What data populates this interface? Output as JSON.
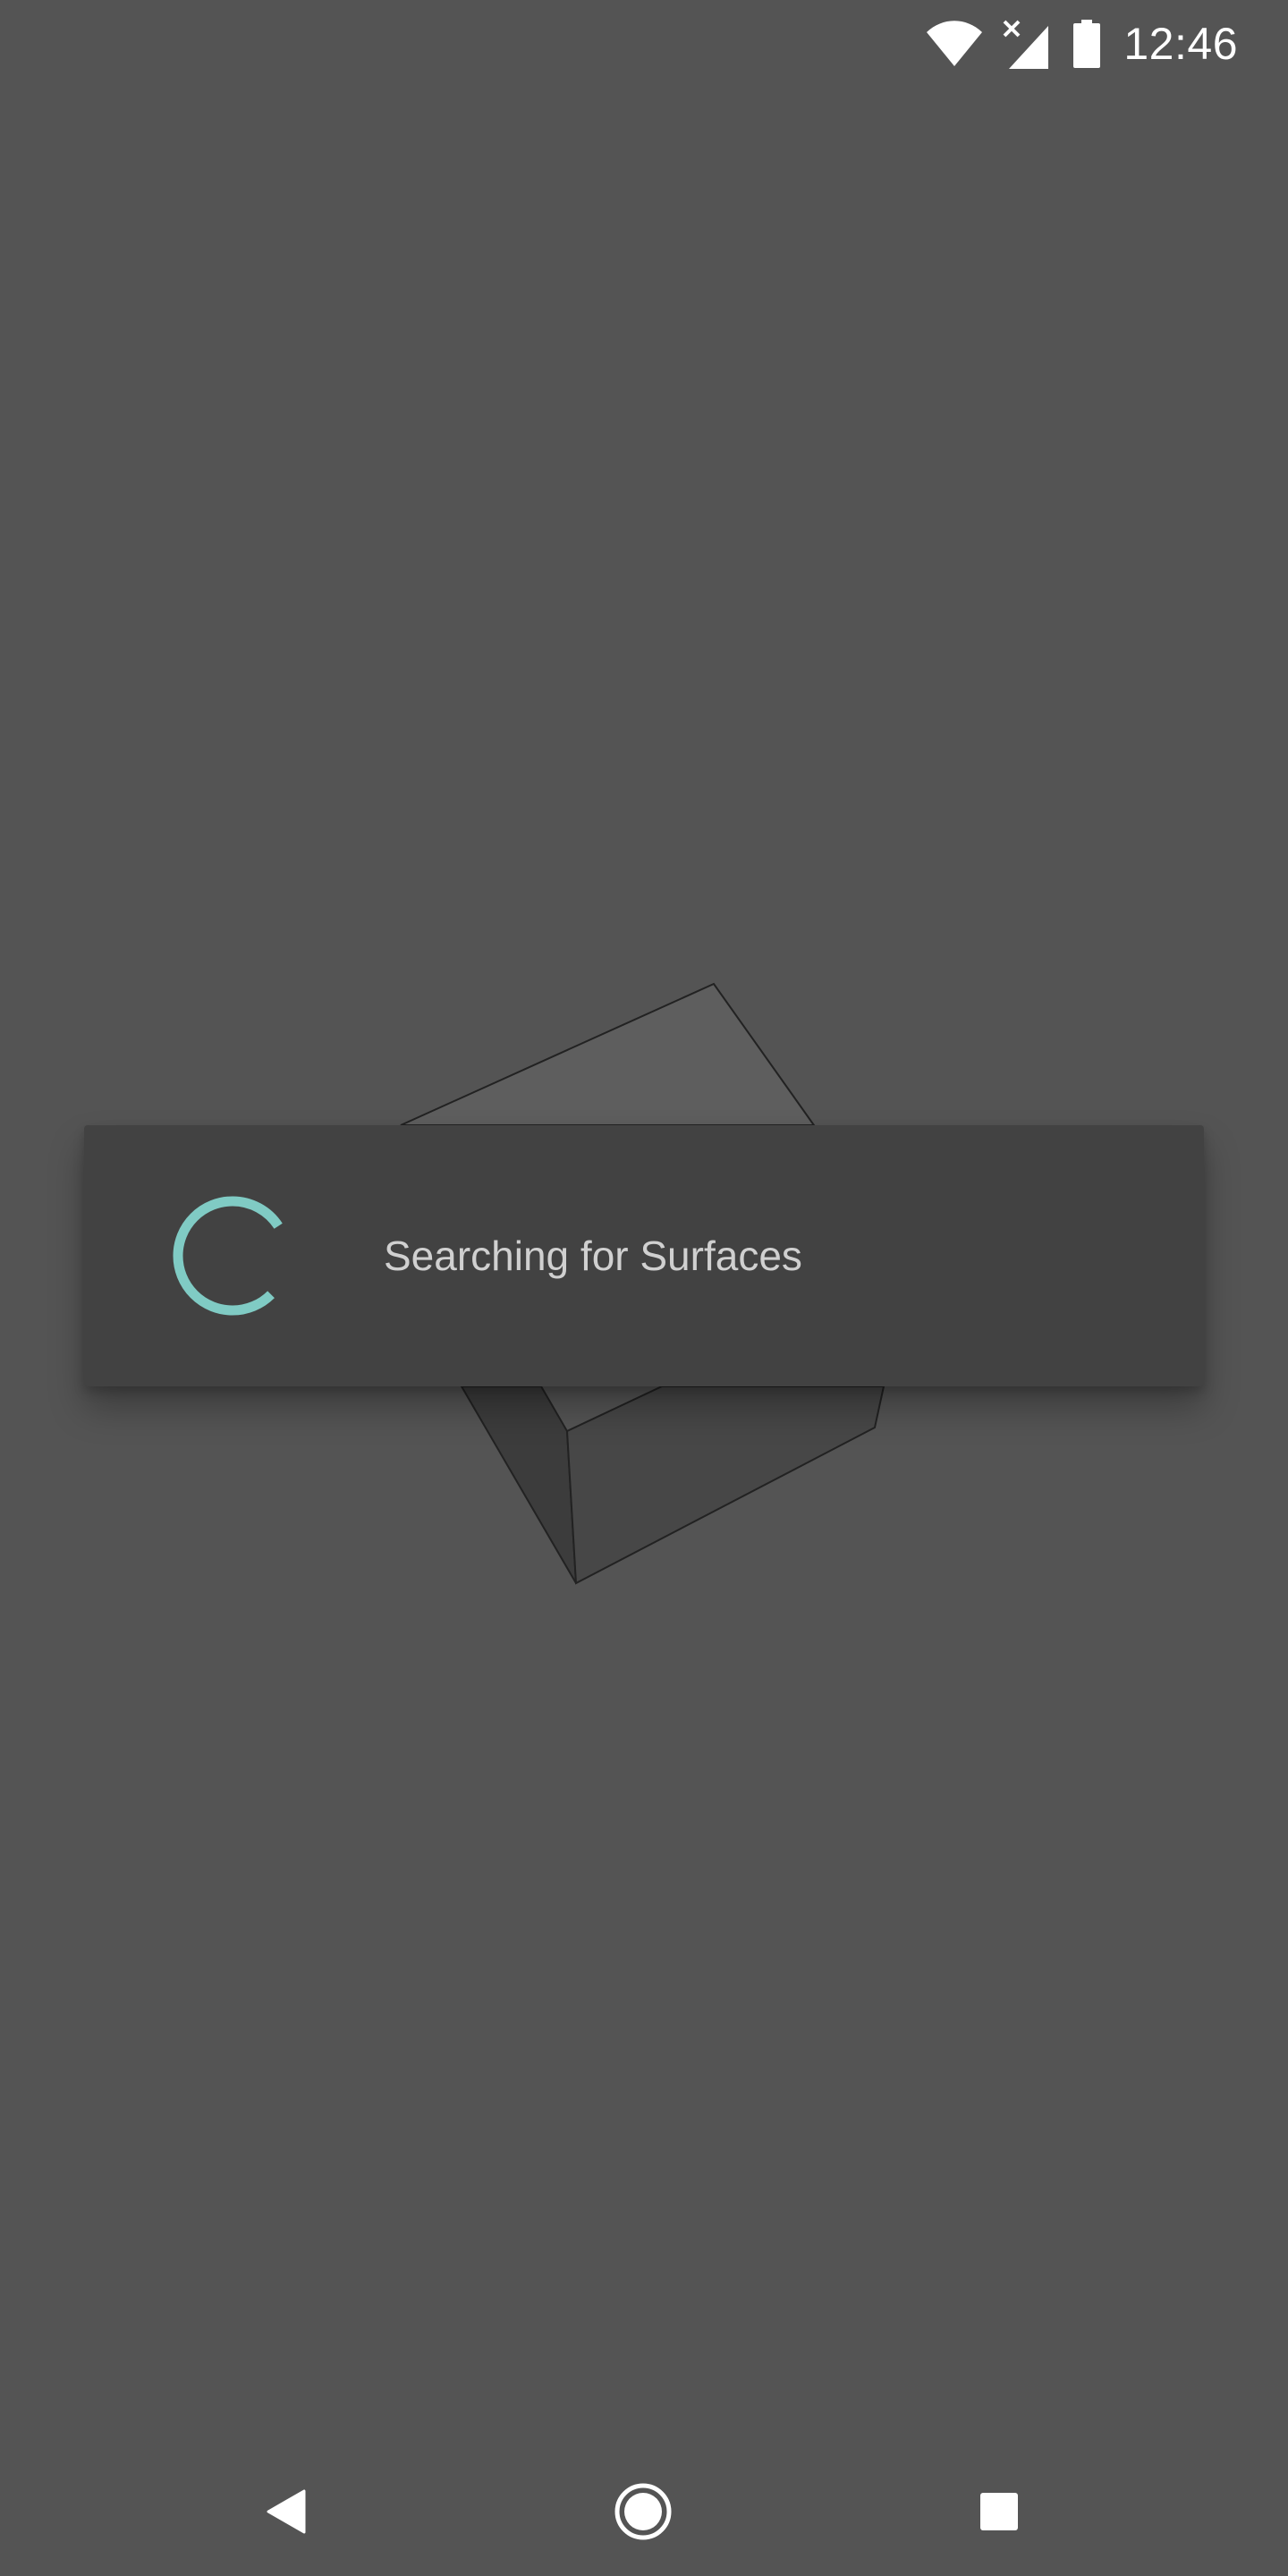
{
  "status_bar": {
    "time": "12:46",
    "icons": [
      "wifi-icon",
      "signal-no-data-icon",
      "battery-icon"
    ]
  },
  "card": {
    "message": "Searching for Surfaces",
    "spinner_icon": "loading-spinner-icon"
  },
  "nav_bar": {
    "buttons": [
      "back-icon",
      "home-icon",
      "recents-icon"
    ]
  },
  "colors": {
    "background": "#545454",
    "card": "#424242",
    "accent": "#80cbc4",
    "text": "#d0d0d0"
  }
}
